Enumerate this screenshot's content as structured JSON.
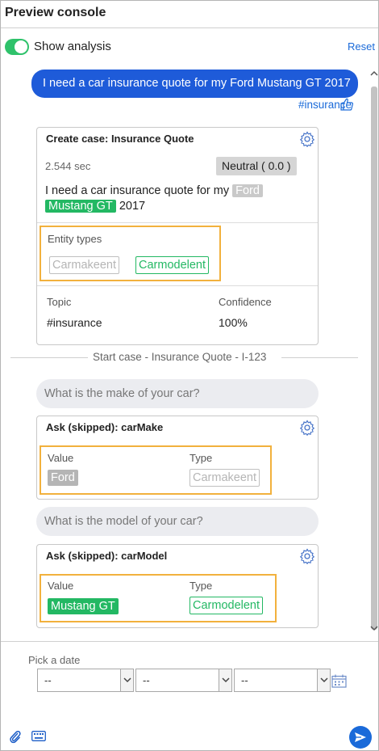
{
  "header": {
    "title": "Preview console"
  },
  "toolbar": {
    "show_analysis_label": "Show analysis",
    "show_analysis_on": true,
    "reset_label": "Reset"
  },
  "chat": {
    "user_message": "I need a car insurance quote for my Ford Mustang GT 2017",
    "user_message_tag": "#insurance",
    "analysis_card": {
      "header": "Create case:  Insurance Quote",
      "time": "2.544 sec",
      "sentiment": "Neutral ( 0.0 )",
      "utterance": {
        "part1": "I need a car insurance quote for my",
        "entity1": "Ford",
        "entity2": "Mustang GT",
        "part2": "2017"
      },
      "entity_types_label": "Entity types",
      "entity_types": [
        "Carmakeent",
        "Carmodelent"
      ],
      "topic_label": "Topic",
      "topic_value": "#insurance",
      "confidence_label": "Confidence",
      "confidence_value": "100%"
    },
    "start_case_text": "Start case - Insurance Quote - I-123",
    "bot_question_1": "What is the make of your car?",
    "ask_card_1": {
      "header": "Ask (skipped):  carMake",
      "value_label": "Value",
      "type_label": "Type",
      "value": "Ford",
      "type": "Carmakeent"
    },
    "bot_question_2": "What is the model of your car?",
    "ask_card_2": {
      "header": "Ask (skipped):  carModel",
      "value_label": "Value",
      "type_label": "Type",
      "value": "Mustang GT",
      "type": "Carmodelent"
    }
  },
  "composer": {
    "pick_date_label": "Pick a date",
    "date_selects": [
      "--",
      "--",
      "--"
    ]
  },
  "colors": {
    "accent_blue": "#1e5bd9",
    "entity_green": "#23b863",
    "highlight_orange": "#f2b13d"
  }
}
